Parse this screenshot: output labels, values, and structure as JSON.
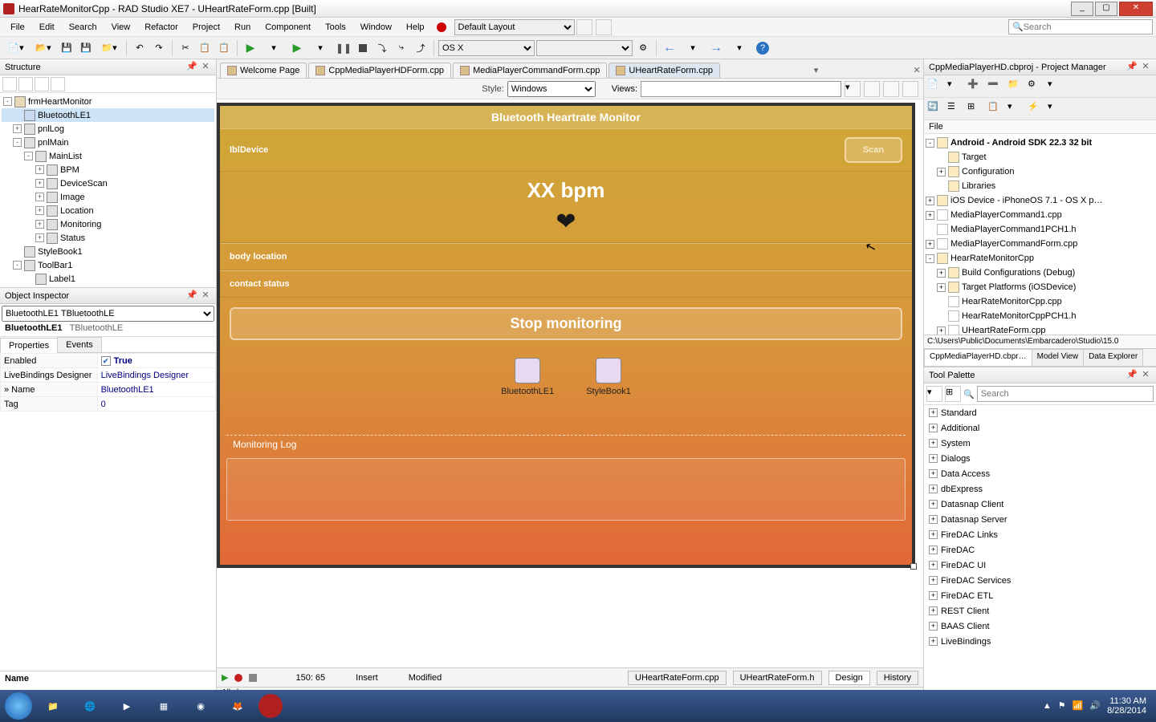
{
  "window": {
    "title": "HearRateMonitorCpp - RAD Studio XE7 - UHeartRateForm.cpp [Built]"
  },
  "menu": {
    "items": [
      "File",
      "Edit",
      "Search",
      "View",
      "Refactor",
      "Project",
      "Run",
      "Component",
      "Tools",
      "Window",
      "Help"
    ],
    "layout_label": "Default Layout",
    "search_placeholder": "Search"
  },
  "toolbar": {
    "target_platform": "OS X"
  },
  "doc_tabs": {
    "items": [
      "Welcome Page",
      "CppMediaPlayerHDForm.cpp",
      "MediaPlayerCommandForm.cpp",
      "UHeartRateForm.cpp"
    ],
    "active_index": 3
  },
  "designer_toolbar": {
    "style_label": "Style:",
    "style_value": "Windows",
    "views_label": "Views:"
  },
  "structure": {
    "title": "Structure",
    "nodes": [
      {
        "label": "frmHeartMonitor",
        "level": 0,
        "exp": "-",
        "icon": "form"
      },
      {
        "label": "BluetoothLE1",
        "level": 1,
        "exp": "",
        "icon": "bt",
        "selected": true
      },
      {
        "label": "pnlLog",
        "level": 1,
        "exp": "+",
        "icon": "panel"
      },
      {
        "label": "pnlMain",
        "level": 1,
        "exp": "-",
        "icon": "panel"
      },
      {
        "label": "MainList",
        "level": 2,
        "exp": "-",
        "icon": "panel"
      },
      {
        "label": "BPM",
        "level": 3,
        "exp": "+",
        "icon": "panel"
      },
      {
        "label": "DeviceScan",
        "level": 3,
        "exp": "+",
        "icon": "panel"
      },
      {
        "label": "Image",
        "level": 3,
        "exp": "+",
        "icon": "panel"
      },
      {
        "label": "Location",
        "level": 3,
        "exp": "+",
        "icon": "panel"
      },
      {
        "label": "Monitoring",
        "level": 3,
        "exp": "+",
        "icon": "panel"
      },
      {
        "label": "Status",
        "level": 3,
        "exp": "+",
        "icon": "panel"
      },
      {
        "label": "StyleBook1",
        "level": 1,
        "exp": "",
        "icon": "panel"
      },
      {
        "label": "ToolBar1",
        "level": 1,
        "exp": "-",
        "icon": "panel"
      },
      {
        "label": "Label1",
        "level": 2,
        "exp": "",
        "icon": "panel"
      }
    ]
  },
  "inspector": {
    "title": "Object Inspector",
    "object_name": "BluetoothLE1",
    "object_type": "TBluetoothLE",
    "tabs": [
      "Properties",
      "Events"
    ],
    "active_tab": 0,
    "props": [
      {
        "k": "Enabled",
        "v": "True",
        "bold": true,
        "check": true
      },
      {
        "k": "LiveBindings Designer",
        "v": "LiveBindings Designer",
        "link": true
      },
      {
        "k": "Name",
        "v": "BluetoothLE1",
        "marker": true
      },
      {
        "k": "Tag",
        "v": "0"
      }
    ],
    "footer": "Name"
  },
  "form": {
    "title": "Bluetooth Heartrate Monitor",
    "device_label": "lblDevice",
    "scan_btn": "Scan",
    "bpm": "XX bpm",
    "body_loc": "body location",
    "contact": "contact status",
    "stop_btn": "Stop monitoring",
    "comp1": "BluetoothLE1",
    "comp2": "StyleBook1",
    "log_title": "Monitoring Log"
  },
  "center_footer": {
    "pos": "150: 65",
    "insert": "Insert",
    "modified": "Modified",
    "tabs": [
      "UHeartRateForm.cpp",
      "UHeartRateForm.h",
      "Design",
      "History"
    ],
    "active": 2
  },
  "all_shown": "All shown",
  "project_manager": {
    "title": "CppMediaPlayerHD.cbproj - Project Manager",
    "file_label": "File",
    "nodes": [
      {
        "label": "Android - Android SDK 22.3 32 bit",
        "level": 0,
        "exp": "-",
        "bold": true
      },
      {
        "label": "Target",
        "level": 1,
        "exp": "",
        "folder": true
      },
      {
        "label": "Configuration",
        "level": 1,
        "exp": "+",
        "folder": true
      },
      {
        "label": "Libraries",
        "level": 1,
        "exp": "",
        "folder": true
      },
      {
        "label": "iOS Device - iPhoneOS 7.1 - OS X p…",
        "level": 0,
        "exp": "+"
      },
      {
        "label": "MediaPlayerCommand1.cpp",
        "level": 0,
        "exp": "+",
        "file": true
      },
      {
        "label": "MediaPlayerCommand1PCH1.h",
        "level": 0,
        "exp": "",
        "file": true
      },
      {
        "label": "MediaPlayerCommandForm.cpp",
        "level": 0,
        "exp": "+",
        "file": true
      },
      {
        "label": "HearRateMonitorCpp",
        "level": 0,
        "exp": "-",
        "bold": false
      },
      {
        "label": "Build Configurations (Debug)",
        "level": 1,
        "exp": "+"
      },
      {
        "label": "Target Platforms (iOSDevice)",
        "level": 1,
        "exp": "+"
      },
      {
        "label": "HearRateMonitorCpp.cpp",
        "level": 1,
        "exp": "",
        "file": true
      },
      {
        "label": "HearRateMonitorCppPCH1.h",
        "level": 1,
        "exp": "",
        "file": true
      },
      {
        "label": "UHeartRateForm.cpp",
        "level": 1,
        "exp": "+",
        "file": true
      }
    ],
    "path": "C:\\Users\\Public\\Documents\\Embarcadero\\Studio\\15.0",
    "tabs": [
      "CppMediaPlayerHD.cbpr…",
      "Model View",
      "Data Explorer"
    ],
    "active_tab": 0
  },
  "palette": {
    "title": "Tool Palette",
    "search_placeholder": "Search",
    "categories": [
      "Standard",
      "Additional",
      "System",
      "Dialogs",
      "Data Access",
      "dbExpress",
      "Datasnap Client",
      "Datasnap Server",
      "FireDAC Links",
      "FireDAC",
      "FireDAC UI",
      "FireDAC Services",
      "FireDAC ETL",
      "REST Client",
      "BAAS Client",
      "LiveBindings"
    ]
  },
  "taskbar": {
    "time": "11:30 AM",
    "date": "8/28/2014"
  }
}
